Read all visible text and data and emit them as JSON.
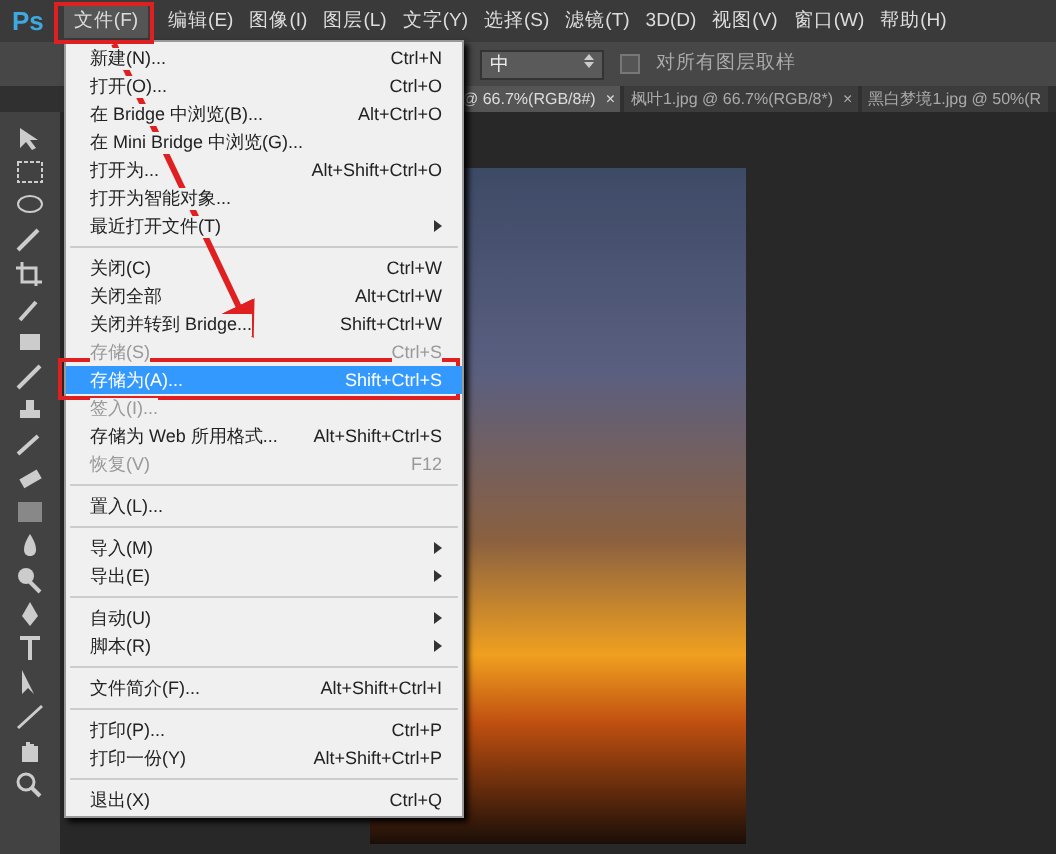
{
  "app": {
    "logo": "Ps"
  },
  "menu_bar": [
    {
      "label": "文件(F)",
      "selected": true
    },
    {
      "label": "编辑(E)",
      "selected": false
    },
    {
      "label": "图像(I)",
      "selected": false
    },
    {
      "label": "图层(L)",
      "selected": false
    },
    {
      "label": "文字(Y)",
      "selected": false
    },
    {
      "label": "选择(S)",
      "selected": false
    },
    {
      "label": "滤镜(T)",
      "selected": false
    },
    {
      "label": "3D(D)",
      "selected": false
    },
    {
      "label": "视图(V)",
      "selected": false
    },
    {
      "label": "窗口(W)",
      "selected": false
    },
    {
      "label": "帮助(H)",
      "selected": false
    }
  ],
  "options_bar": {
    "sample_value": "中",
    "all_layers": {
      "label": "对所有图层取样",
      "checked": false
    }
  },
  "document_tabs": [
    {
      "label": "@ 66.7%(RGB/8#)",
      "close": "×",
      "selected": true
    },
    {
      "label": "枫叶1.jpg @ 66.7%(RGB/8*)",
      "close": "×",
      "selected": false
    },
    {
      "label": "黑白梦境1.jpg @ 50%(R",
      "selected": false
    }
  ],
  "file_menu": {
    "groups": [
      [
        {
          "label": "新建(N)...",
          "shortcut": "Ctrl+N",
          "disabled": false,
          "selected": false
        },
        {
          "label": "打开(O)...",
          "shortcut": "Ctrl+O",
          "disabled": false,
          "selected": false
        },
        {
          "label": "在 Bridge 中浏览(B)...",
          "shortcut": "Alt+Ctrl+O",
          "disabled": false,
          "selected": false
        },
        {
          "label": "在 Mini Bridge 中浏览(G)...",
          "disabled": false,
          "selected": false
        },
        {
          "label": "打开为...",
          "shortcut": "Alt+Shift+Ctrl+O",
          "disabled": false,
          "selected": false
        },
        {
          "label": "打开为智能对象...",
          "disabled": false,
          "selected": false
        },
        {
          "label": "最近打开文件(T)",
          "submenu": true,
          "disabled": false,
          "selected": false
        }
      ],
      [
        {
          "label": "关闭(C)",
          "shortcut": "Ctrl+W",
          "disabled": false,
          "selected": false
        },
        {
          "label": "关闭全部",
          "shortcut": "Alt+Ctrl+W",
          "disabled": false,
          "selected": false
        },
        {
          "label": "关闭并转到 Bridge...",
          "shortcut": "Shift+Ctrl+W",
          "disabled": false,
          "selected": false
        },
        {
          "label": "存储(S)",
          "shortcut": "Ctrl+S",
          "disabled": true,
          "selected": false
        },
        {
          "label": "存储为(A)...",
          "shortcut": "Shift+Ctrl+S",
          "disabled": false,
          "selected": true
        },
        {
          "label": "签入(I)...",
          "disabled": true,
          "selected": false
        },
        {
          "label": "存储为 Web 所用格式...",
          "shortcut": "Alt+Shift+Ctrl+S",
          "disabled": false,
          "selected": false
        },
        {
          "label": "恢复(V)",
          "shortcut": "F12",
          "disabled": true,
          "selected": false
        }
      ],
      [
        {
          "label": "置入(L)...",
          "disabled": false,
          "selected": false
        }
      ],
      [
        {
          "label": "导入(M)",
          "submenu": true,
          "disabled": false,
          "selected": false
        },
        {
          "label": "导出(E)",
          "submenu": true,
          "disabled": false,
          "selected": false
        }
      ],
      [
        {
          "label": "自动(U)",
          "submenu": true,
          "disabled": false,
          "selected": false
        },
        {
          "label": "脚本(R)",
          "submenu": true,
          "disabled": false,
          "selected": false
        }
      ],
      [
        {
          "label": "文件简介(F)...",
          "shortcut": "Alt+Shift+Ctrl+I",
          "disabled": false,
          "selected": false
        }
      ],
      [
        {
          "label": "打印(P)...",
          "shortcut": "Ctrl+P",
          "disabled": false,
          "selected": false
        },
        {
          "label": "打印一份(Y)",
          "shortcut": "Alt+Shift+Ctrl+P",
          "disabled": false,
          "selected": false
        }
      ],
      [
        {
          "label": "退出(X)",
          "shortcut": "Ctrl+Q",
          "disabled": false,
          "selected": false
        }
      ]
    ]
  }
}
